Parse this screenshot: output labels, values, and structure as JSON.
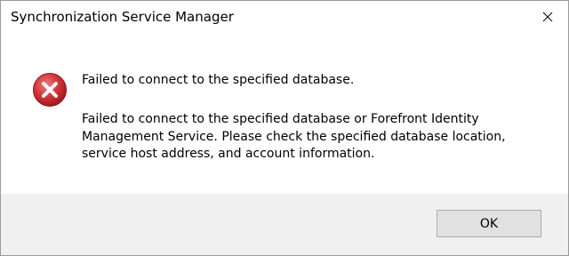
{
  "window": {
    "title": "Synchronization Service Manager",
    "close_glyph": "✕"
  },
  "icon": {
    "name": "error-icon",
    "color": "#c3282e"
  },
  "message": {
    "main": "Failed to connect to the specified database.",
    "detail": "Failed to connect to the specified database or Forefront Identity Management Service. Please check the specified database location, service host address, and account information."
  },
  "buttons": {
    "ok_label": "OK"
  }
}
